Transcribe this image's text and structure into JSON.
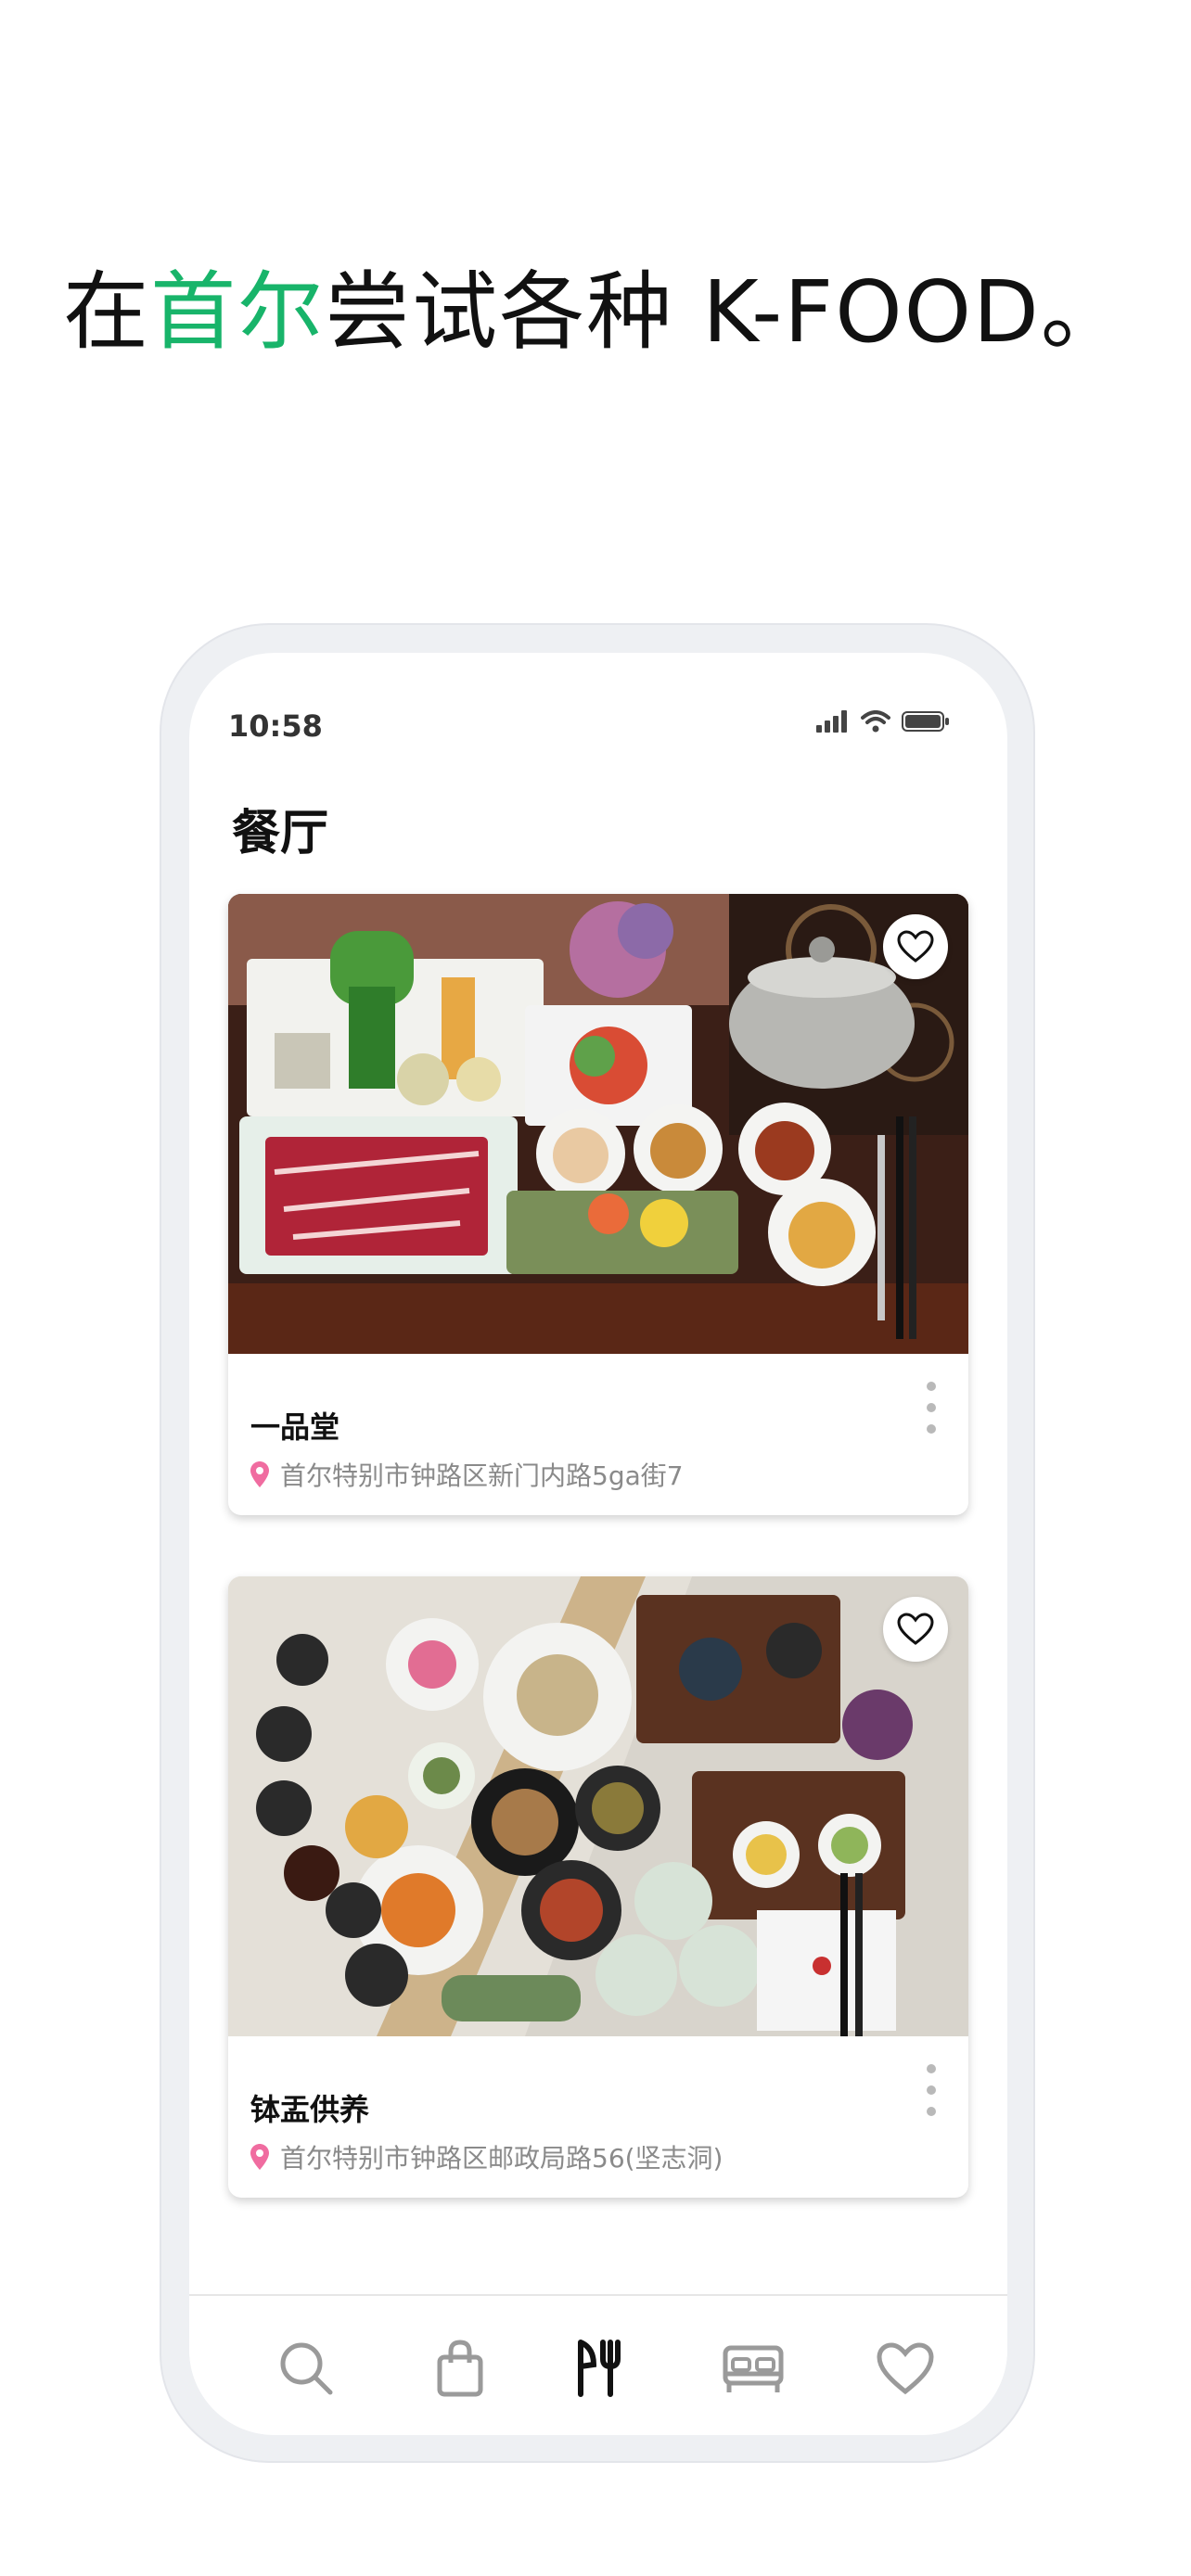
{
  "headline": {
    "prefix": "在",
    "accent": "首尔",
    "suffix": "尝试各种 K-FOOD。",
    "accent_color": "#18b46a"
  },
  "status_bar": {
    "time": "10:58",
    "icons": [
      "cellular-signal-icon",
      "wifi-icon",
      "battery-icon"
    ]
  },
  "page": {
    "title": "餐厅"
  },
  "restaurants": [
    {
      "name": "一品堂",
      "address": "首尔特别市钟路区新门内路5ga街7",
      "favorite_icon": "heart-outline-icon",
      "more_icon": "more-vertical-icon"
    },
    {
      "name": "钵盂供养",
      "address": "首尔特别市钟路区邮政局路56(坚志洞)",
      "favorite_icon": "heart-outline-icon",
      "more_icon": "more-vertical-icon"
    }
  ],
  "tab_bar": {
    "tabs": [
      {
        "icon": "search-icon",
        "active": false
      },
      {
        "icon": "shopping-bag-icon",
        "active": false
      },
      {
        "icon": "restaurant-icon",
        "active": true
      },
      {
        "icon": "bed-icon",
        "active": false
      },
      {
        "icon": "heart-icon",
        "active": false
      }
    ],
    "active_color": "#111111",
    "inactive_color": "#9a9a9a"
  },
  "colors": {
    "location_pin": "#f06ca0"
  }
}
